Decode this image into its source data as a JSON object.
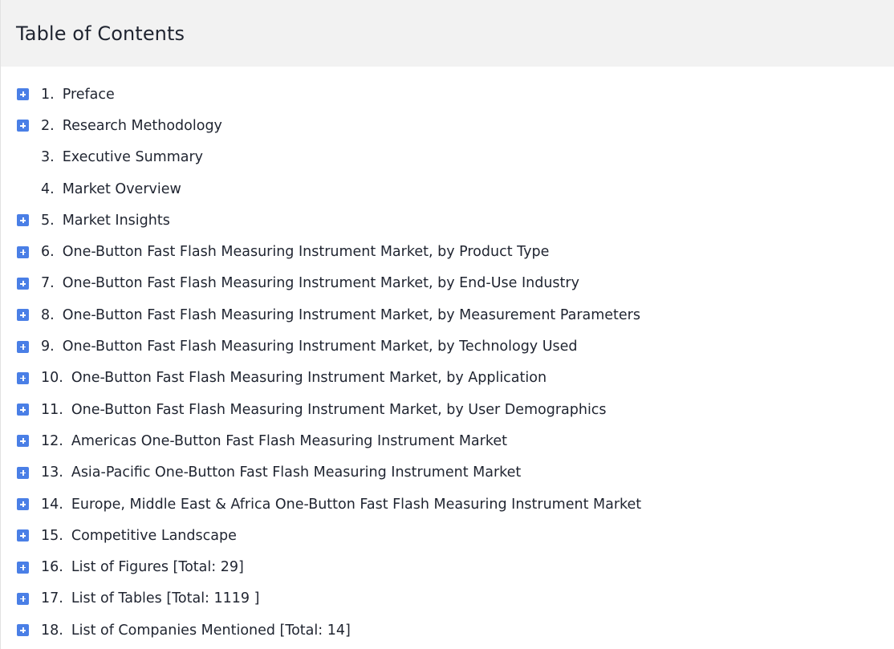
{
  "toc": {
    "title": "Table of Contents",
    "colors": {
      "toggle_bg": "#4a7fe6",
      "header_bg": "#f2f2f2",
      "text": "#1f2430"
    },
    "toggle_icon": "plus-icon",
    "items": [
      {
        "num": "1.",
        "label": "Preface",
        "expandable": true
      },
      {
        "num": "2.",
        "label": "Research Methodology",
        "expandable": true
      },
      {
        "num": "3.",
        "label": "Executive Summary",
        "expandable": false
      },
      {
        "num": "4.",
        "label": "Market Overview",
        "expandable": false
      },
      {
        "num": "5.",
        "label": "Market Insights",
        "expandable": true
      },
      {
        "num": "6.",
        "label": "One-Button Fast Flash Measuring Instrument Market, by Product Type",
        "expandable": true
      },
      {
        "num": "7.",
        "label": "One-Button Fast Flash Measuring Instrument Market, by End-Use Industry",
        "expandable": true
      },
      {
        "num": "8.",
        "label": "One-Button Fast Flash Measuring Instrument Market, by Measurement Parameters",
        "expandable": true
      },
      {
        "num": "9.",
        "label": "One-Button Fast Flash Measuring Instrument Market, by Technology Used",
        "expandable": true
      },
      {
        "num": "10.",
        "label": "One-Button Fast Flash Measuring Instrument Market, by Application",
        "expandable": true
      },
      {
        "num": "11.",
        "label": "One-Button Fast Flash Measuring Instrument Market, by User Demographics",
        "expandable": true
      },
      {
        "num": "12.",
        "label": "Americas One-Button Fast Flash Measuring Instrument Market",
        "expandable": true
      },
      {
        "num": "13.",
        "label": "Asia-Pacific One-Button Fast Flash Measuring Instrument Market",
        "expandable": true
      },
      {
        "num": "14.",
        "label": "Europe, Middle East & Africa One-Button Fast Flash Measuring Instrument Market",
        "expandable": true
      },
      {
        "num": "15.",
        "label": "Competitive Landscape",
        "expandable": true
      },
      {
        "num": "16.",
        "label": "List of Figures [Total: 29]",
        "expandable": true
      },
      {
        "num": "17.",
        "label": "List of Tables [Total: 1119 ]",
        "expandable": true
      },
      {
        "num": "18.",
        "label": "List of Companies Mentioned [Total: 14]",
        "expandable": true
      }
    ]
  }
}
